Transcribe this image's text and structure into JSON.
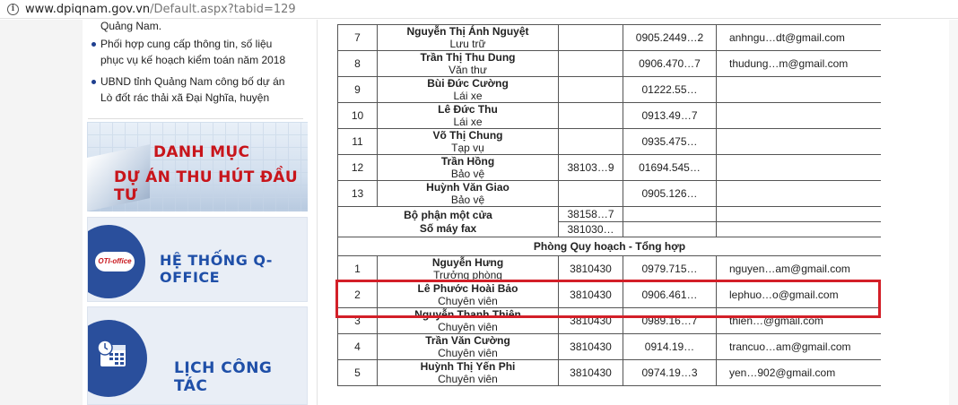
{
  "browser": {
    "url_host": "www.dpiqnam.gov.vn",
    "url_path": "/Default.aspx?tabid=129"
  },
  "sidebar": {
    "news_fragment": "Quảng Nam.",
    "news": [
      "Phối hợp cung cấp thông tin, số liệu phục vụ kế hoạch kiểm toán năm 2018",
      "UBND tỉnh Quảng Nam công bố dự án Lò đốt rác thải xã Đại Nghĩa, huyện"
    ],
    "banner1_line1": "DANH MỤC",
    "banner1_line2": "DỰ ÁN THU HÚT ĐẦU TƯ",
    "banner2_logo": "OTI-office",
    "banner2_text": "HỆ THỐNG Q-OFFICE",
    "banner3_text": "LỊCH CÔNG TÁC"
  },
  "table": {
    "rows_a": [
      {
        "stt": "7",
        "name": "Nguyễn Thị Ánh Nguyệt",
        "pos": "Lưu trữ",
        "phone": "",
        "mobile": "0905.2449…2",
        "email": "anhngu…dt@gmail.com"
      },
      {
        "stt": "8",
        "name": "Trần Thị Thu Dung",
        "pos": "Văn thư",
        "phone": "",
        "mobile": "0906.470…7",
        "email": "thudung…m@gmail.com"
      },
      {
        "stt": "9",
        "name": "Bùi Đức Cường",
        "pos": "Lái xe",
        "phone": "",
        "mobile": "01222.55…",
        "email": ""
      },
      {
        "stt": "10",
        "name": "Lê Đức Thu",
        "pos": "Lái xe",
        "phone": "",
        "mobile": "0913.49…7",
        "email": ""
      },
      {
        "stt": "11",
        "name": "Võ Thị Chung",
        "pos": "Tạp vụ",
        "phone": "",
        "mobile": "0935.475…",
        "email": ""
      },
      {
        "stt": "12",
        "name": "Trần Hồng",
        "pos": "Bảo vệ",
        "phone": "38103…9",
        "mobile": "01694.545…",
        "email": ""
      },
      {
        "stt": "13",
        "name": "Huỳnh Văn Giao",
        "pos": "Bảo vệ",
        "phone": "",
        "mobile": "0905.126…",
        "email": ""
      }
    ],
    "bpmc_line1": "Bộ phận một cửa",
    "bpmc_line2": "Số máy fax",
    "bpmc_phone1": "38158…7",
    "bpmc_phone2": "381030…",
    "section_title": "Phòng Quy hoạch - Tổng hợp",
    "rows_b": [
      {
        "stt": "1",
        "name": "Nguyễn Hưng",
        "pos": "Trưởng phòng",
        "phone": "3810430",
        "mobile": "0979.715…",
        "email": "nguyen…am@gmail.com"
      },
      {
        "stt": "2",
        "name": "Lê Phước Hoài Bảo",
        "pos": "Chuyên viên",
        "phone": "3810430",
        "mobile": "0906.461…",
        "email": "lephuo…o@gmail.com"
      },
      {
        "stt": "3",
        "name": "Nguyễn Thanh Thiên",
        "pos": "Chuyên viên",
        "phone": "3810430",
        "mobile": "0989.16…7",
        "email": "thien…@gmail.com"
      },
      {
        "stt": "4",
        "name": "Trần Văn Cường",
        "pos": "Chuyên viên",
        "phone": "3810430",
        "mobile": "0914.19…",
        "email": "trancuo…am@gmail.com"
      },
      {
        "stt": "5",
        "name": "Huỳnh Thị Yến Phi",
        "pos": "Chuyên viên",
        "phone": "3810430",
        "mobile": "0974.19…3",
        "email": "yen…902@gmail.com"
      }
    ]
  },
  "colors": {
    "highlight": "#d31f28",
    "banner_red": "#c8151b",
    "banner_blue": "#1f4fa8"
  }
}
